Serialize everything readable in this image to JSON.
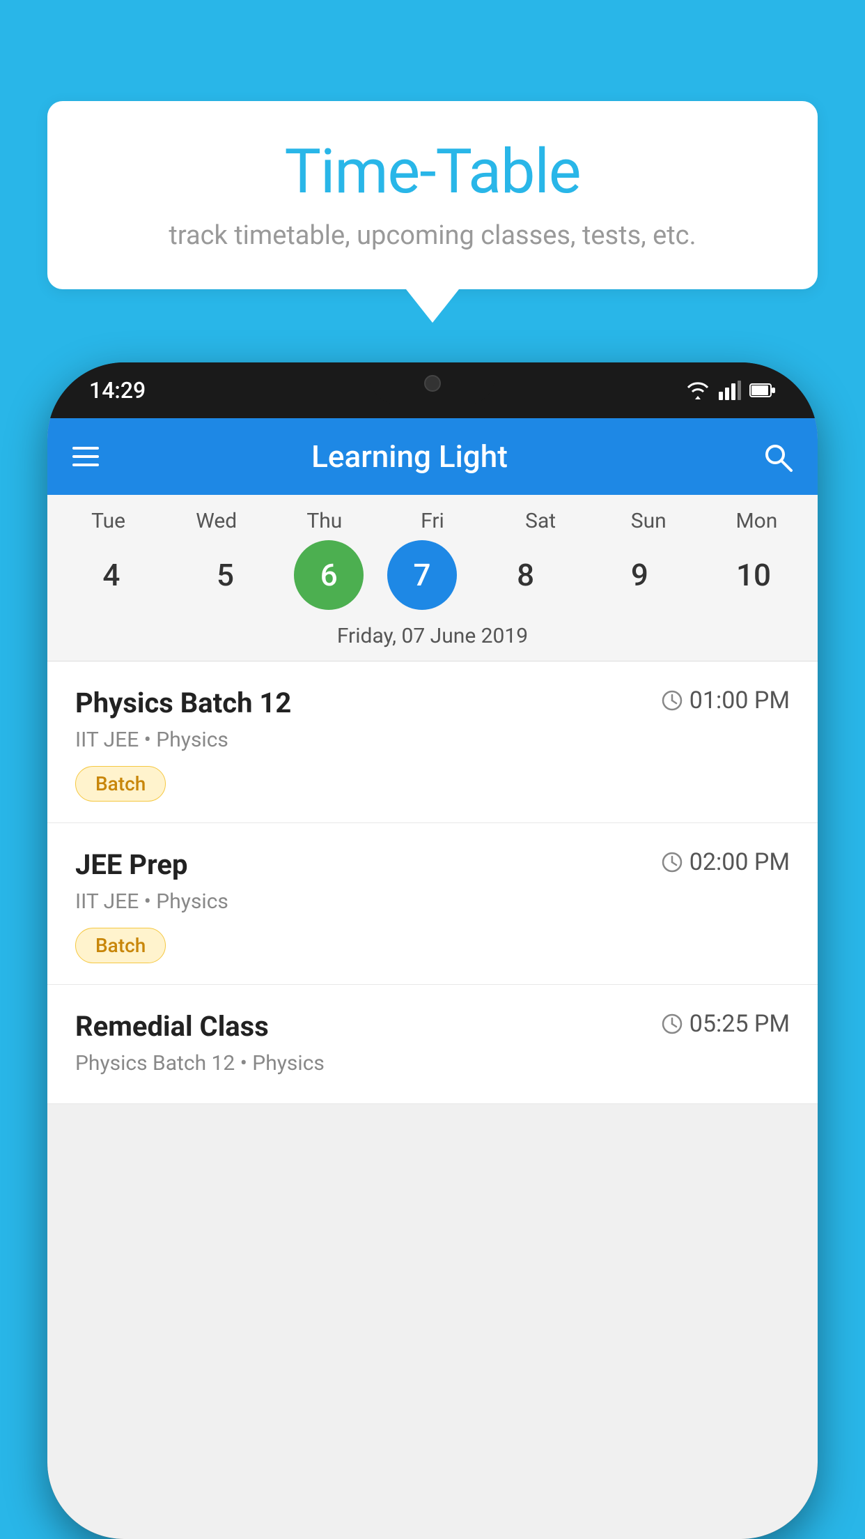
{
  "background_color": "#29B6E8",
  "speech_bubble": {
    "title": "Time-Table",
    "subtitle": "track timetable, upcoming classes, tests, etc."
  },
  "phone": {
    "status_bar": {
      "time": "14:29"
    },
    "toolbar": {
      "title": "Learning Light"
    },
    "calendar": {
      "days": [
        "Tue",
        "Wed",
        "Thu",
        "Fri",
        "Sat",
        "Sun",
        "Mon"
      ],
      "dates": [
        "4",
        "5",
        "6",
        "7",
        "8",
        "9",
        "10"
      ],
      "today_index": 2,
      "selected_index": 3,
      "selected_date_label": "Friday, 07 June 2019"
    },
    "classes": [
      {
        "name": "Physics Batch 12",
        "time": "01:00 PM",
        "meta": "IIT JEE • Physics",
        "badge": "Batch"
      },
      {
        "name": "JEE Prep",
        "time": "02:00 PM",
        "meta": "IIT JEE • Physics",
        "badge": "Batch"
      },
      {
        "name": "Remedial Class",
        "time": "05:25 PM",
        "meta": "Physics Batch 12 • Physics",
        "badge": ""
      }
    ]
  }
}
